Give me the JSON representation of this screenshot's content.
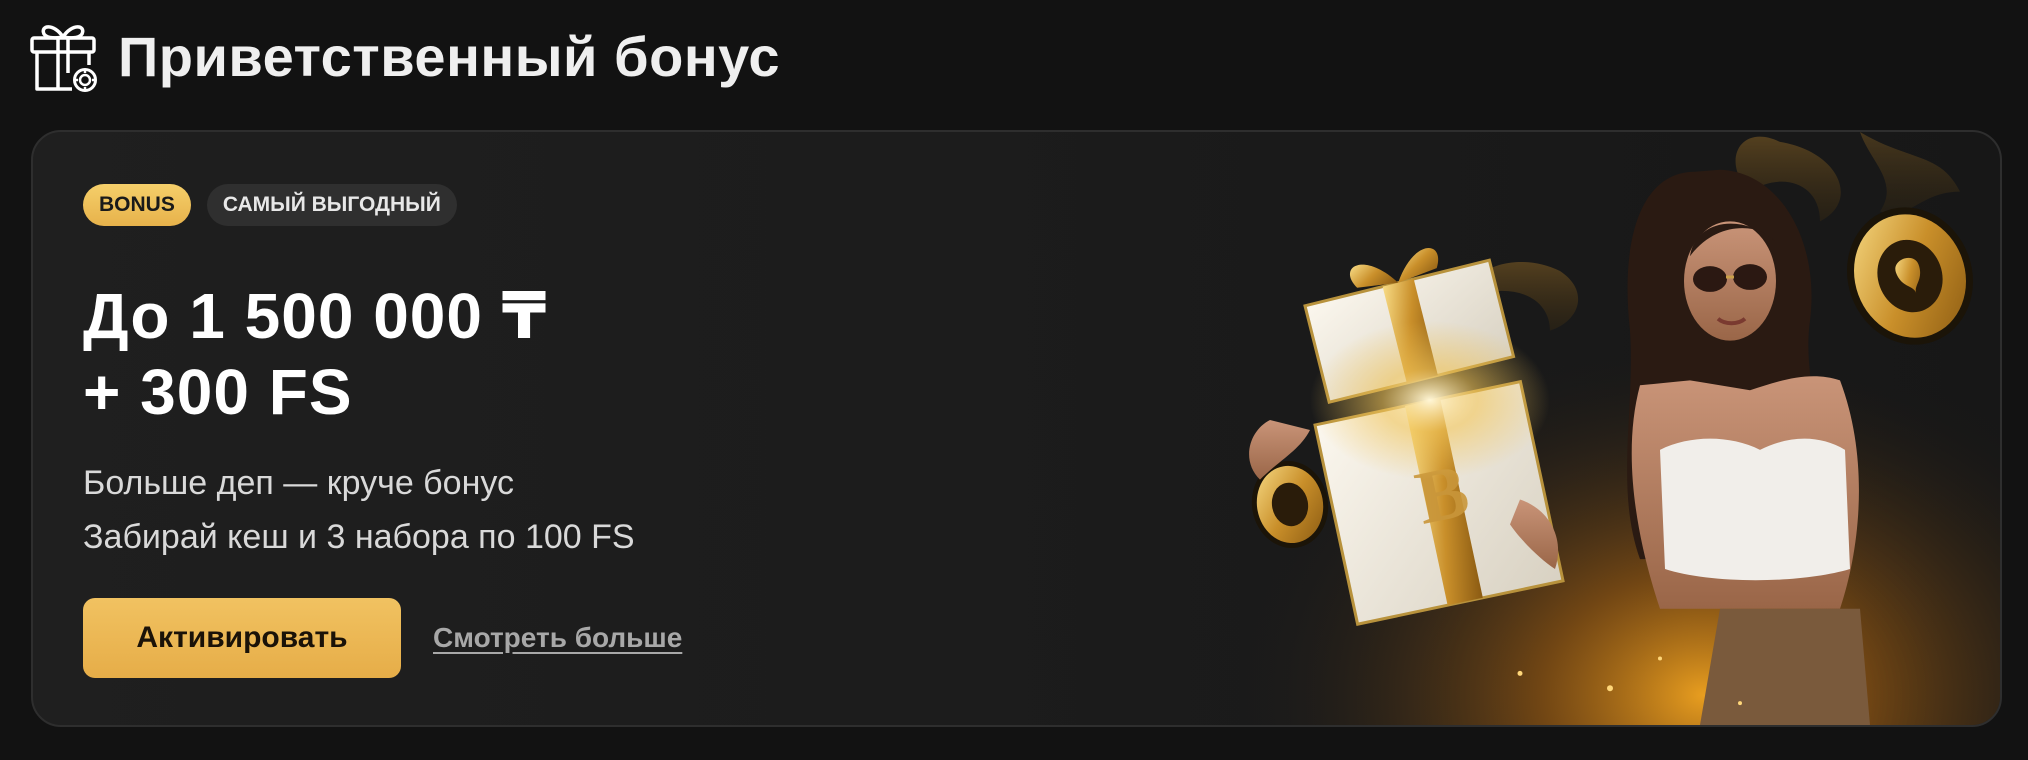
{
  "header": {
    "icon": "gift-icon",
    "title": "Приветственный бонус"
  },
  "card": {
    "badges": {
      "bonus": "BONUS",
      "best": "САМЫЙ ВЫГОДНЫЙ"
    },
    "amount_line1": "До 1 500 000 ₸",
    "amount_line2": "+ 300 FS",
    "subtitle_line1": "Больше деп — круче бонус",
    "subtitle_line2": "Забирай кеш и 3 набора по 100 FS",
    "activate_label": "Активировать",
    "more_label": "Смотреть больше",
    "illustration": "promo-illustration-woman-gift-box-chips"
  },
  "colors": {
    "background": "#121212",
    "card": "#1d1d1d",
    "accent": "#eab453",
    "badge_dark": "#2f2f2f"
  }
}
